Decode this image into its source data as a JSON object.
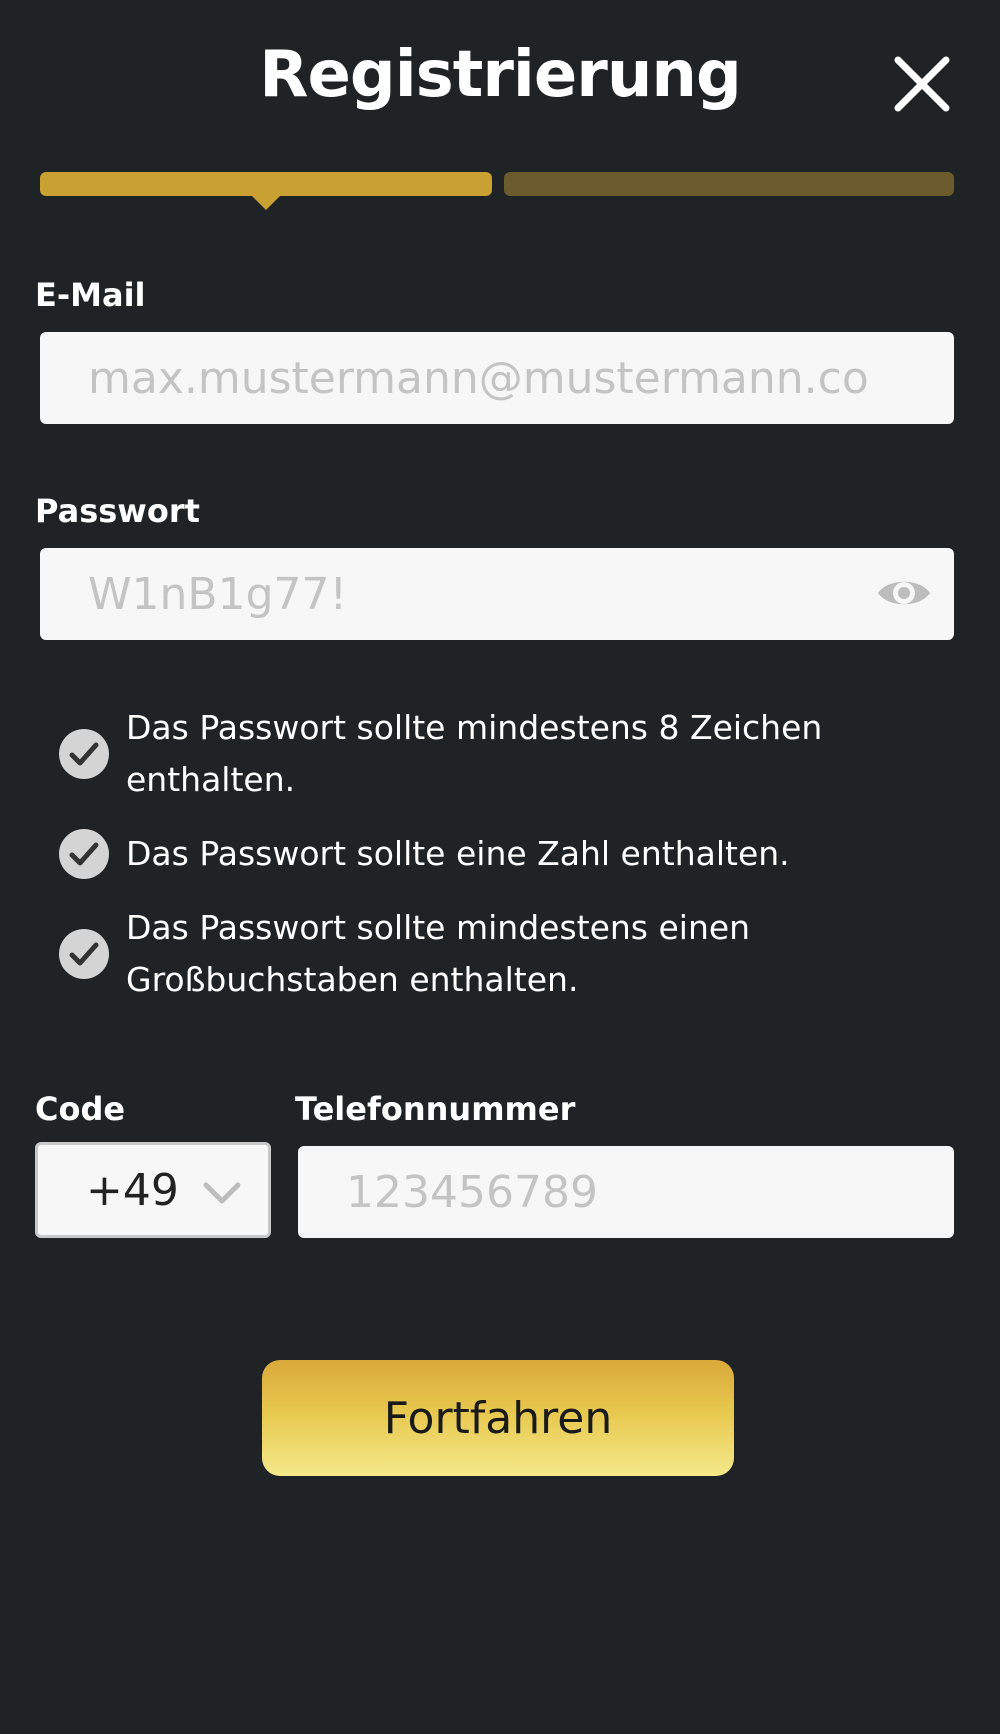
{
  "header": {
    "title": "Registrierung",
    "close_icon": "close-icon"
  },
  "progress": {
    "total_steps": 2,
    "current_step": 1,
    "active_color": "#c9a133",
    "inactive_color": "#6a5a2c"
  },
  "form": {
    "email": {
      "label": "E-Mail",
      "placeholder": "max.mustermann@mustermann.co"
    },
    "password": {
      "label": "Passwort",
      "placeholder": "W1nB1g77!",
      "toggle_icon": "eye-icon"
    },
    "password_rules": [
      {
        "text": "Das Passwort sollte mindestens 8 Zeichen enthalten.",
        "line1": "Das Passwort sollte mindestens 8 Zeichen",
        "line2": "enthalten.",
        "satisfied": true
      },
      {
        "text": "Das Passwort sollte eine Zahl enthalten.",
        "line1": "Das Passwort sollte eine Zahl enthalten.",
        "satisfied": true
      },
      {
        "text": "Das Passwort sollte mindestens einen Großbuchstaben enthalten.",
        "line1": "Das Passwort sollte mindestens einen",
        "line2": "Großbuchstaben enthalten.",
        "satisfied": true
      }
    ],
    "code": {
      "label": "Code",
      "selected": "+49",
      "icon": "chevron-down-icon"
    },
    "phone": {
      "label": "Telefonnummer",
      "placeholder": "123456789"
    }
  },
  "actions": {
    "continue_label": "Fortfahren"
  },
  "colors": {
    "background": "#1f2326",
    "accent": "#c9a133",
    "button_gradient_top": "#d9a93a",
    "button_gradient_bottom": "#f4e98a"
  }
}
